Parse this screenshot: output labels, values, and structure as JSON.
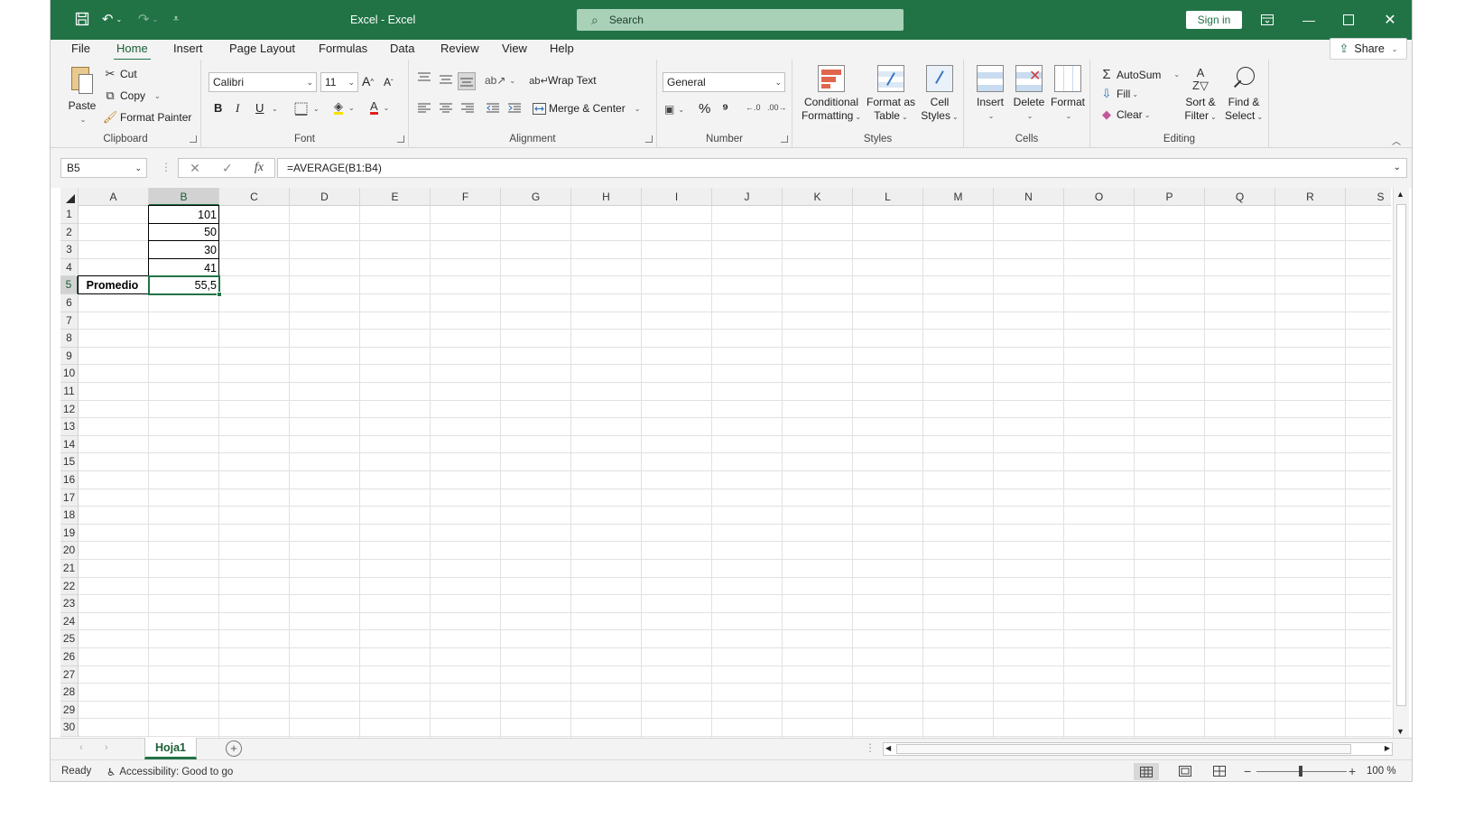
{
  "app": {
    "title": "Excel  -  Excel",
    "search_placeholder": "Search",
    "sign_in": "Sign in",
    "share": "Share",
    "accent": "#217346"
  },
  "tabs": [
    "File",
    "Home",
    "Insert",
    "Page Layout",
    "Formulas",
    "Data",
    "Review",
    "View",
    "Help"
  ],
  "ribbon": {
    "clipboard": {
      "label": "Clipboard",
      "paste": "Paste",
      "cut": "Cut",
      "copy": "Copy",
      "format_painter": "Format Painter"
    },
    "font": {
      "label": "Font",
      "font_name": "Calibri",
      "font_size": "11",
      "bold": "B",
      "italic": "I",
      "underline": "U"
    },
    "alignment": {
      "label": "Alignment",
      "wrap_text": "Wrap Text",
      "merge_center": "Merge & Center"
    },
    "number": {
      "label": "Number",
      "format": "General"
    },
    "styles": {
      "label": "Styles",
      "conditional_line1": "Conditional",
      "conditional_line2": "Formatting",
      "format_table_line1": "Format as",
      "format_table_line2": "Table",
      "cell_styles_line1": "Cell",
      "cell_styles_line2": "Styles"
    },
    "cells": {
      "label": "Cells",
      "insert": "Insert",
      "delete": "Delete",
      "format": "Format"
    },
    "editing": {
      "label": "Editing",
      "autosum": "AutoSum",
      "fill": "Fill",
      "clear": "Clear",
      "sort_line1": "Sort &",
      "sort_line2": "Filter",
      "find_line1": "Find &",
      "find_line2": "Select"
    }
  },
  "formula_bar": {
    "name_box": "B5",
    "formula": "=AVERAGE(B1:B4)",
    "fx": "fx"
  },
  "columns": [
    "A",
    "B",
    "C",
    "D",
    "E",
    "F",
    "G",
    "H",
    "I",
    "J",
    "K",
    "L",
    "M",
    "N",
    "O",
    "P",
    "Q",
    "R",
    "S"
  ],
  "rows": [
    "1",
    "2",
    "3",
    "4",
    "5",
    "6",
    "7",
    "8",
    "9",
    "10",
    "11",
    "12",
    "13",
    "14",
    "15",
    "16",
    "17",
    "18",
    "19",
    "20",
    "21",
    "22",
    "23",
    "24",
    "25",
    "26",
    "27",
    "28",
    "29",
    "30"
  ],
  "cells": {
    "B1": "101",
    "B2": "50",
    "B3": "30",
    "B4": "41",
    "A5": "Promedio",
    "B5": "55,5"
  },
  "sheet_tabs": [
    "Hoja1"
  ],
  "status": {
    "ready": "Ready",
    "accessibility": "Accessibility: Good to go",
    "zoom": "100 %"
  }
}
